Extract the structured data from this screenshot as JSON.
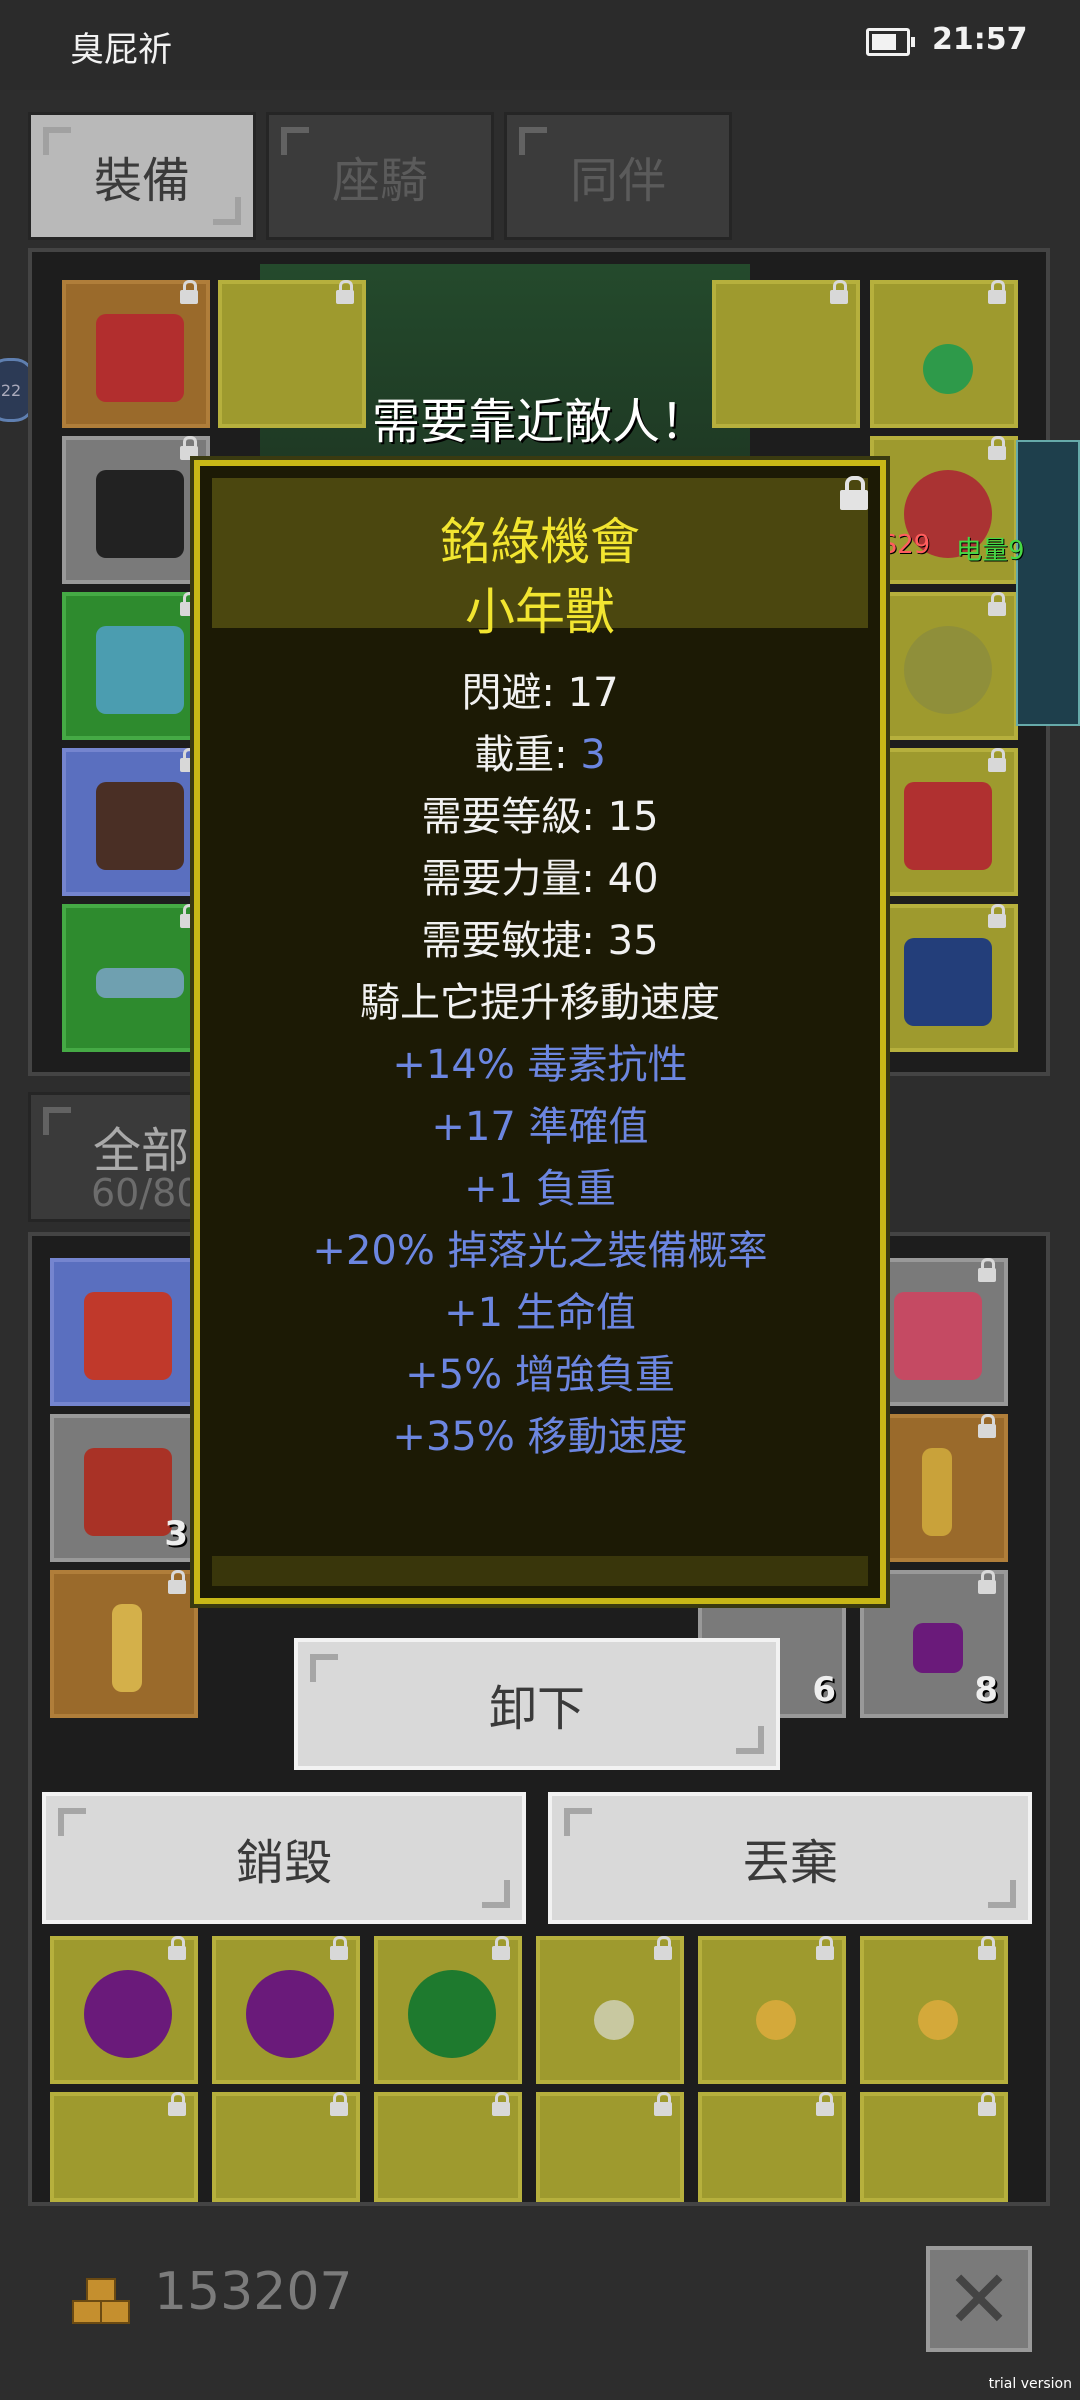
{
  "status_bar": {
    "carrier": "臭屁祈",
    "time": "21:57"
  },
  "tabs": [
    {
      "label": "裝備",
      "active": true
    },
    {
      "label": "座騎",
      "active": false
    },
    {
      "label": "同伴",
      "active": false
    }
  ],
  "message": "需要靠近敵人！",
  "overlay": {
    "fps": "FPS29",
    "battery": "电量9",
    "left_badge": "22"
  },
  "inventory": {
    "tab_label": "全部",
    "count": "60/80"
  },
  "inventory_slots": [
    {
      "qty": "3"
    },
    {
      "qty": "6"
    },
    {
      "qty": "8"
    }
  ],
  "tooltip": {
    "title": "銘綠機會",
    "subtitle": "小年獸",
    "stats": [
      {
        "label": "閃避: ",
        "value": "17"
      },
      {
        "label": "載重: ",
        "value": "3"
      },
      {
        "label": "需要等級: ",
        "value": "15"
      },
      {
        "label": "需要力量: ",
        "value": "40"
      },
      {
        "label": "需要敏捷: ",
        "value": "35"
      }
    ],
    "description": "騎上它提升移動速度",
    "bonuses": [
      "+14% 毒素抗性",
      "+17 準確值",
      "+1 負重",
      "+20% 掉落光之裝備概率",
      "+1 生命值",
      "+5% 增強負重",
      "+35% 移動速度"
    ]
  },
  "actions": {
    "unequip": "卸下",
    "destroy": "銷毀",
    "discard": "丟棄"
  },
  "footer": {
    "gold": "153207",
    "trial": "trial version"
  },
  "colors": {
    "tooltip_border": "#c8b817",
    "title": "#f2e530",
    "bonus": "#6c86e0"
  }
}
